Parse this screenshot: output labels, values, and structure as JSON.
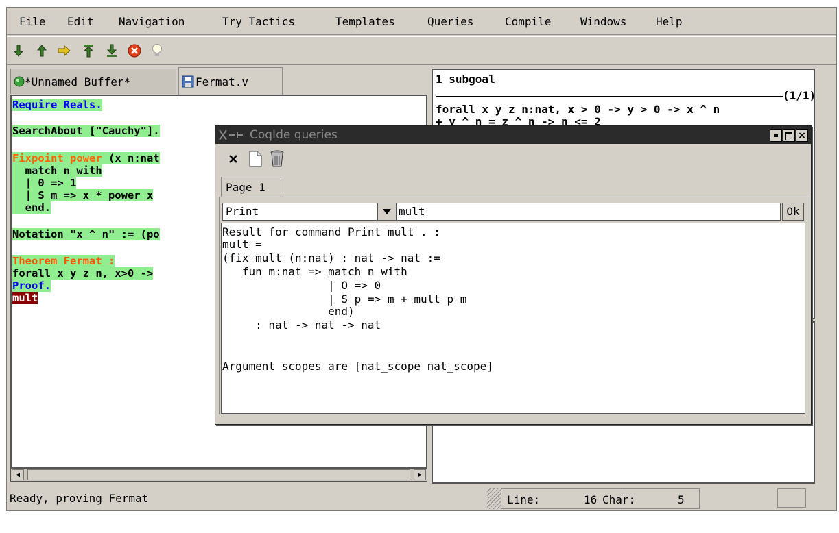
{
  "menubar": {
    "items": [
      "File",
      "Edit",
      "Navigation",
      "Try Tactics",
      "Templates",
      "Queries",
      "Compile",
      "Windows",
      "Help"
    ]
  },
  "toolbar": {
    "buttons": [
      "forward-icon",
      "backward-icon",
      "goto-icon",
      "start-icon",
      "end-icon",
      "interrupt-icon",
      "hint-icon"
    ]
  },
  "tabs": [
    {
      "label": "*Unnamed Buffer*",
      "icon": "status-ball-icon"
    },
    {
      "label": "Fermat.v",
      "icon": "save-disk-icon"
    }
  ],
  "editor": {
    "lines": [
      {
        "text": "Require Reals.",
        "color": "#0000ff",
        "highlight": false
      },
      {
        "text": "",
        "color": "#000000",
        "highlight": false
      },
      {
        "text": "SearchAbout [\"Cauchy\"].",
        "color": "#000000",
        "highlight": true
      },
      {
        "text": "",
        "color": "#000000",
        "highlight": false
      },
      {
        "text": "Fixpoint power (x n:nat",
        "color": "#000000",
        "highlight": true
      },
      {
        "text": "  match n with",
        "color": "#000000",
        "highlight": true
      },
      {
        "text": "  | 0 => 1",
        "color": "#000000",
        "highlight": true
      },
      {
        "text": "  | S m => x * power x",
        "color": "#000000",
        "highlight": true
      },
      {
        "text": "  end.",
        "color": "#000000",
        "highlight": true
      },
      {
        "text": "",
        "color": "#000000",
        "highlight": false
      },
      {
        "text": "Notation \"x ^ n\" := (po",
        "color": "#000000",
        "highlight": true
      },
      {
        "text": "",
        "color": "#000000",
        "highlight": false
      },
      {
        "text": "Theorem Fermat :",
        "color": "#ff6600",
        "highlight": true
      },
      {
        "text": "forall x y z n, x>0 ->",
        "color": "#000000",
        "highlight": true
      },
      {
        "text": "Proof.",
        "color": "#0000ff",
        "highlight": true
      },
      {
        "text": "mult",
        "color": "#ffffff",
        "highlight": false
      }
    ],
    "fixpoint_keyword": "Fixpoint power",
    "fixpoint_rest": " (x n:nat"
  },
  "goals": {
    "count_line": "1 subgoal",
    "index": "(1/1)",
    "goal_line1": "forall x y z n:nat, x > 0 -> y > 0 -> x ^ n",
    "goal_line2": "+ y ^ n = z ^ n -> n <= 2"
  },
  "statusbar": {
    "message": "Ready, proving Fermat",
    "line_label": "Line:",
    "line_value": "16",
    "char_label": "Char:",
    "char_value": "5"
  },
  "queries_window": {
    "title": "CoqIde queries",
    "page_tab": "Page 1",
    "command": "Print",
    "argument": "mult",
    "ok_label": "Ok",
    "result_lines": [
      "Result for command Print mult . :",
      "mult =",
      "(fix mult (n:nat) : nat -> nat :=",
      "   fun m:nat => match n with",
      "                | O => 0",
      "                | S p => m + mult p m",
      "                end)",
      "     : nat -> nat -> nat",
      "",
      "",
      "Argument scopes are [nat_scope nat_scope]"
    ]
  }
}
